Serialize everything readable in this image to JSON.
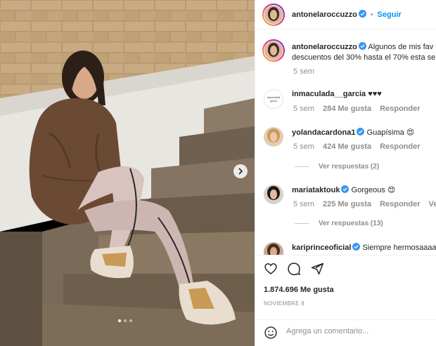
{
  "post": {
    "author": "antonelaroccuzzo",
    "follow_label": "Seguir",
    "separator": "•",
    "caption_line1": "Algunos de mis fav",
    "caption_line2": "descuentos del 30% hasta el 70% esta se",
    "caption_time": "5 sem",
    "likes": "1.874.696 Me gusta",
    "date": "NOVIEMBRE 8",
    "carousel": {
      "slide_count": 3,
      "active_index": 0
    }
  },
  "comments": [
    {
      "user": "inmaculada__garcia",
      "text": "♥♥♥",
      "time": "5 sem",
      "likes": "284 Me gusta",
      "reply": "Responder",
      "verified": false,
      "avatar_text": "inmaculada garcia"
    },
    {
      "user": "yolandacardona1",
      "text": "Guapísima 😍",
      "time": "5 sem",
      "likes": "424 Me gusta",
      "reply": "Responder",
      "verified": true,
      "view_replies": "Ver respuestas (2)"
    },
    {
      "user": "mariataktouk",
      "text": "Gorgeous 😍",
      "time": "5 sem",
      "likes": "225 Me gusta",
      "reply": "Responder",
      "verified": true,
      "translate": "Ver tradu",
      "view_replies": "Ver respuestas (13)"
    },
    {
      "user": "kariprinceoficial",
      "text": "Siempre hermosaaaa",
      "verified": true
    }
  ],
  "comment_box": {
    "placeholder": "Agrega un comentario..."
  },
  "icons": {
    "like": "heart-icon",
    "comment": "comment-icon",
    "share": "share-icon",
    "emoji": "emoji-icon",
    "next": "chevron-right-icon",
    "verified": "verified-badge-icon"
  },
  "colors": {
    "accent": "#0095f6",
    "verified": "#3897f0",
    "muted": "#8e8e8e",
    "text": "#262626"
  }
}
